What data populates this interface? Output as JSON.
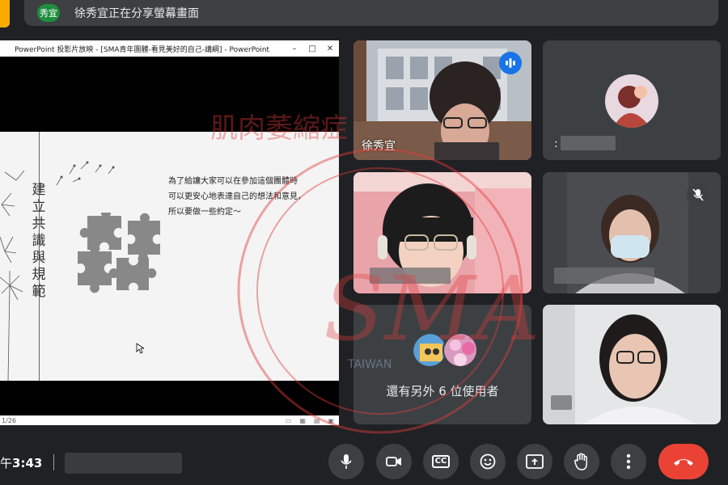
{
  "share_banner": {
    "avatar_text": "秀宜",
    "text": "徐秀宜正在分享螢幕畫面"
  },
  "presentation": {
    "window_title": "PowerPoint 投影片放映 - [SMA青年團體-看見美好的自己-講綱] - PowerPoint",
    "slide_vertical_title": [
      "建",
      "立",
      "共",
      "識",
      "與",
      "規",
      "範"
    ],
    "slide_body_lines": [
      "為了給讓大家可以在參加這個團體時",
      "可以更安心地表達自己的想法和意見，",
      "所以要做一些約定～"
    ],
    "status_page": "1/26"
  },
  "participants": [
    {
      "name": "徐秀宜",
      "speaking": true
    },
    {
      "name": ":"
    }
  ],
  "others": {
    "text": "還有另外 6 位使用者"
  },
  "clock": {
    "prefix": "午",
    "time": "3:43"
  },
  "controls": {
    "mic": "microphone-icon",
    "camera": "camera-icon",
    "captions": "CC",
    "emoji": "emoji-icon",
    "present": "present-icon",
    "raise_hand": "hand-icon",
    "more": "more-vert-icon",
    "end_call": "end-call-icon"
  },
  "colors": {
    "accent": "#8ab4f8",
    "end_call": "#ea4335",
    "share_avatar": "#1e8e3e"
  }
}
